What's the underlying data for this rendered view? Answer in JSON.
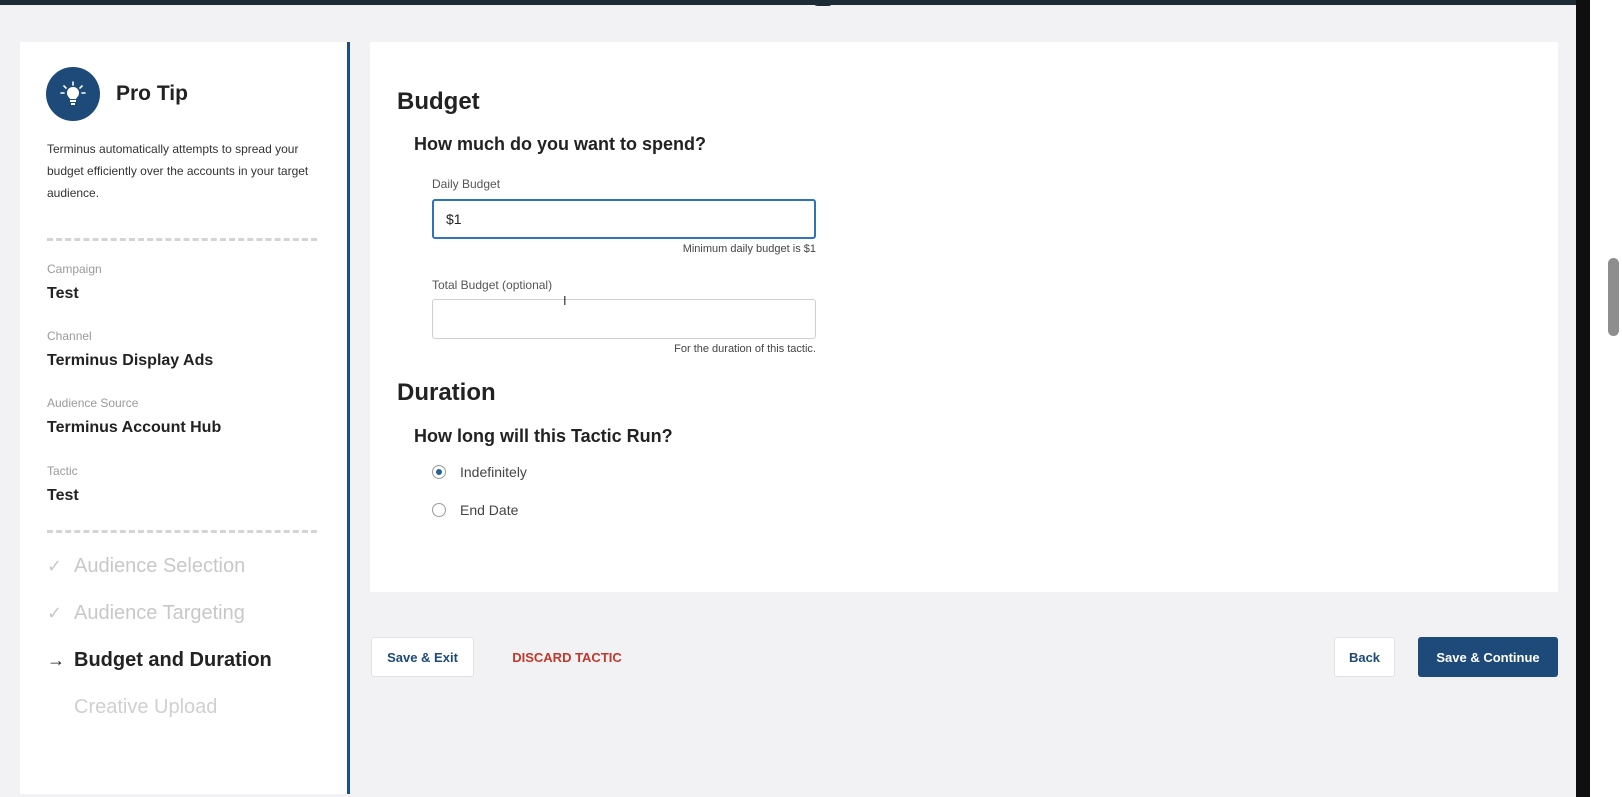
{
  "sidebar": {
    "tip_title": "Pro Tip",
    "tip_icon": "lightbulb-icon",
    "tip_text": "Terminus automatically attempts to spread your budget efficiently over the accounts in your target audience.",
    "meta": [
      {
        "label": "Campaign",
        "value": "Test"
      },
      {
        "label": "Channel",
        "value": "Terminus Display Ads"
      },
      {
        "label": "Audience Source",
        "value": "Terminus Account Hub"
      },
      {
        "label": "Tactic",
        "value": "Test"
      }
    ],
    "steps": [
      {
        "label": "Audience Selection",
        "state": "done",
        "mark": "✓"
      },
      {
        "label": "Audience Targeting",
        "state": "done",
        "mark": "✓"
      },
      {
        "label": "Budget and Duration",
        "state": "current",
        "mark": "→"
      },
      {
        "label": "Creative Upload",
        "state": "future",
        "mark": ""
      }
    ]
  },
  "budget": {
    "heading": "Budget",
    "question": "How much do you want to spend?",
    "daily_label": "Daily Budget",
    "daily_value": "$1",
    "daily_hint": "Minimum daily budget is $1",
    "total_label": "Total Budget (optional)",
    "total_value": "",
    "total_hint": "For the duration of this tactic."
  },
  "duration": {
    "heading": "Duration",
    "question": "How long will this Tactic Run?",
    "options": [
      {
        "label": "Indefinitely",
        "selected": true
      },
      {
        "label": "End Date",
        "selected": false
      }
    ]
  },
  "footer": {
    "save_exit": "Save & Exit",
    "discard": "DISCARD TACTIC",
    "back": "Back",
    "save_continue": "Save & Continue"
  },
  "colors": {
    "primary": "#1d4a79",
    "focus": "#2f73b8",
    "danger": "#c0392b",
    "background": "#f2f2f4"
  }
}
